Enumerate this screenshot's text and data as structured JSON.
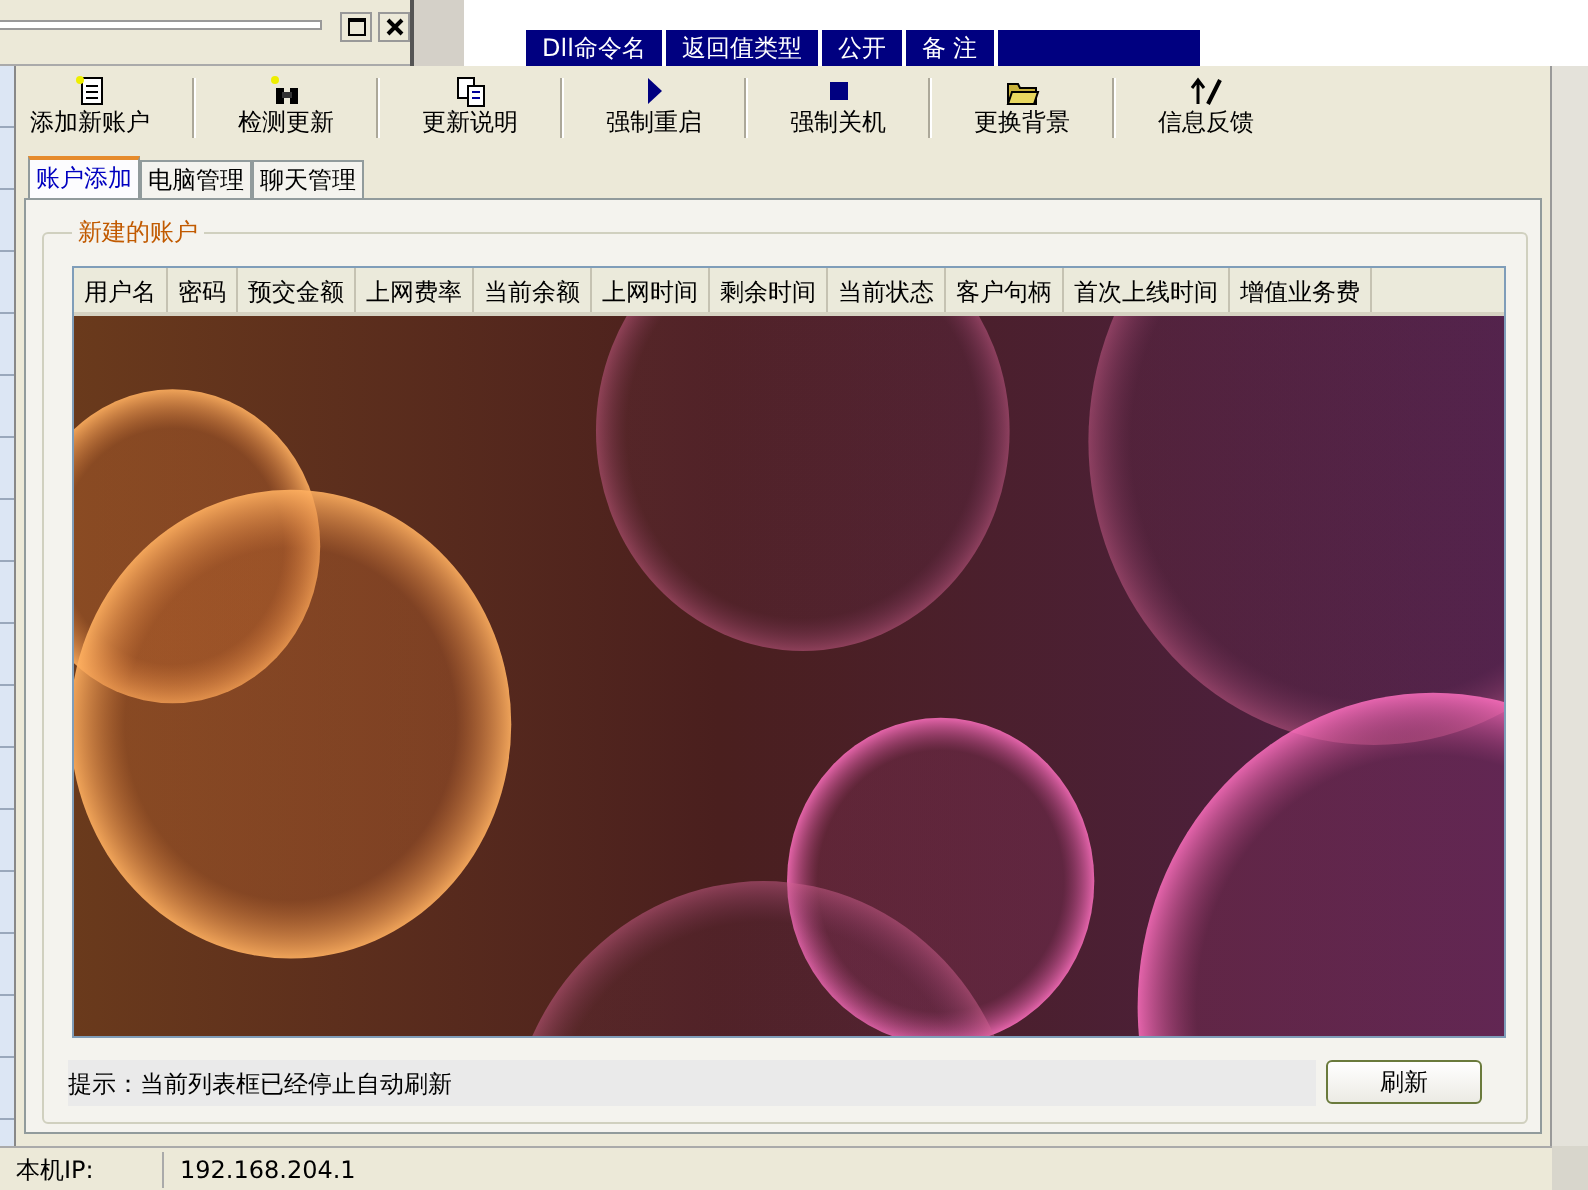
{
  "background_window": {
    "columns": [
      "Dll命令名",
      "返回值类型",
      "公开",
      "备 注"
    ]
  },
  "toolbar": [
    {
      "label": "添加新账户",
      "kind": "document"
    },
    {
      "label": "检测更新",
      "kind": "binoculars"
    },
    {
      "label": "更新说明",
      "kind": "copy"
    },
    {
      "label": "强制重启",
      "kind": "play"
    },
    {
      "label": "强制关机",
      "kind": "stop"
    },
    {
      "label": "更换背景",
      "kind": "folder"
    },
    {
      "label": "信息反馈",
      "kind": "pen"
    }
  ],
  "tabs": [
    {
      "label": "账户添加",
      "selected": true
    },
    {
      "label": "电脑管理",
      "selected": false
    },
    {
      "label": "聊天管理",
      "selected": false
    }
  ],
  "group": {
    "title": "新建的账户",
    "table": {
      "columns": [
        "用户名",
        "密码",
        "预交金额",
        "上网费率",
        "当前余额",
        "上网时间",
        "剩余时间",
        "当前状态",
        "客户句柄",
        "首次上线时间",
        "增值业务费"
      ]
    },
    "hint": "提示：当前列表框已经停止自动刷新",
    "refresh_button": "刷新"
  },
  "status_bar": {
    "label": "本机IP:",
    "value": "192.168.204.1"
  }
}
